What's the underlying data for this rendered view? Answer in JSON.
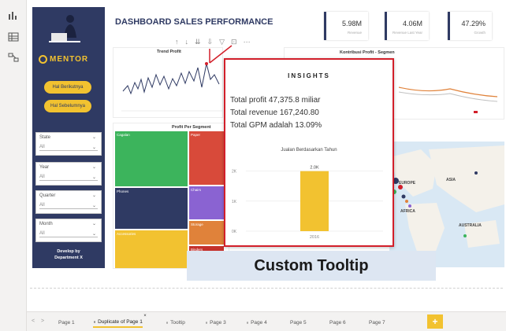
{
  "dashboard_title": "DASHBOARD SALES PERFORMANCE",
  "brand": "MENTOR",
  "nav_buttons": {
    "next": "Hal Berikutnya",
    "prev": "Hal Sebelumnya"
  },
  "slicers": [
    {
      "title": "State",
      "value": "All"
    },
    {
      "title": "Year",
      "value": "All"
    },
    {
      "title": "Quarter",
      "value": "All"
    },
    {
      "title": "Month",
      "value": "All"
    }
  ],
  "developer": {
    "line1": "Develop by",
    "line2": "Department X"
  },
  "kpis": [
    {
      "value": "5.98M",
      "label": "Revenue"
    },
    {
      "value": "4.06M",
      "label": "Revenue Last Year"
    },
    {
      "value": "47.29%",
      "label": "Growth"
    }
  ],
  "visual_titles": {
    "trend": "Trend Profit",
    "contribution": "Kontribusi Profit - Segmen",
    "segment": "Profit Per Segment"
  },
  "treemap_labels": [
    "Cagalan",
    "Paper",
    "Tables",
    "Phones",
    "Chairs",
    "Storage",
    "Accessories",
    "Binders"
  ],
  "map_labels": [
    "EUROPE",
    "ASIA",
    "AFRICA",
    "AUSTRALIA"
  ],
  "tooltip": {
    "title": "INSIGHTS",
    "lines": [
      "Total profit 47,375.8 miliar",
      "Total revenue 167,240.80",
      "Total GPM adalah 13.09%"
    ],
    "chart_title": "Jualan Berdasarkan Tahun"
  },
  "chart_data": {
    "type": "bar",
    "title": "Jualan Berdasarkan Tahun",
    "categories": [
      "2016"
    ],
    "values": [
      2.0
    ],
    "data_labels": [
      "2.0K"
    ],
    "y_ticks": [
      "2K",
      "1K",
      "0K"
    ],
    "ylim": [
      0,
      2.2
    ],
    "colors": [
      "#f2c230"
    ]
  },
  "banner": "Custom Tooltip",
  "tabs": [
    "Page 1",
    "Duplicate of Page 1",
    "Tooltip",
    "Page 3",
    "Page 4",
    "Page 5",
    "Page 6",
    "Page 7"
  ],
  "add_tab": "+",
  "colors": {
    "navy": "#2f3a63",
    "accent": "#f2c230",
    "highlight": "#d21f2a"
  }
}
